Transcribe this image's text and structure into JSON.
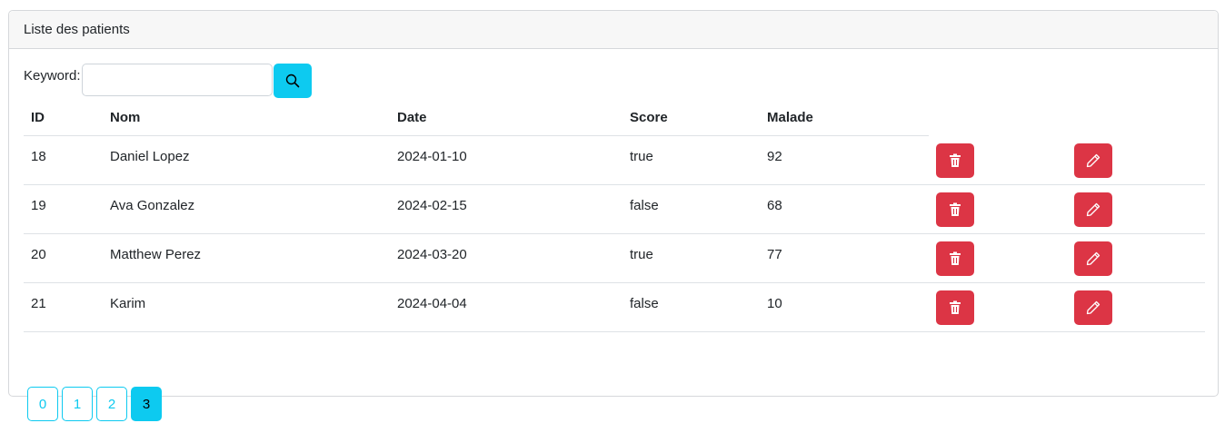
{
  "card": {
    "title": "Liste des patients"
  },
  "search": {
    "label": "Keyword:",
    "value": "",
    "placeholder": "",
    "button_icon": "search-icon"
  },
  "table": {
    "headers": [
      "ID",
      "Nom",
      "Date",
      "Score",
      "Malade"
    ],
    "rows": [
      {
        "id": "18",
        "nom": "Daniel Lopez",
        "date": "2024-01-10",
        "score": "true",
        "malade": "92"
      },
      {
        "id": "19",
        "nom": "Ava Gonzalez",
        "date": "2024-02-15",
        "score": "false",
        "malade": "68"
      },
      {
        "id": "20",
        "nom": "Matthew Perez",
        "date": "2024-03-20",
        "score": "true",
        "malade": "77"
      },
      {
        "id": "21",
        "nom": "Karim",
        "date": "2024-04-04",
        "score": "false",
        "malade": "10"
      }
    ],
    "delete_icon": "trash-icon",
    "edit_icon": "pencil-icon"
  },
  "pagination": {
    "pages": [
      "0",
      "1",
      "2",
      "3"
    ],
    "active": "3"
  },
  "colors": {
    "info": "#0dcaf0",
    "danger": "#dc3545",
    "border": "#dee2e6",
    "header_bg": "#f7f7f7"
  }
}
